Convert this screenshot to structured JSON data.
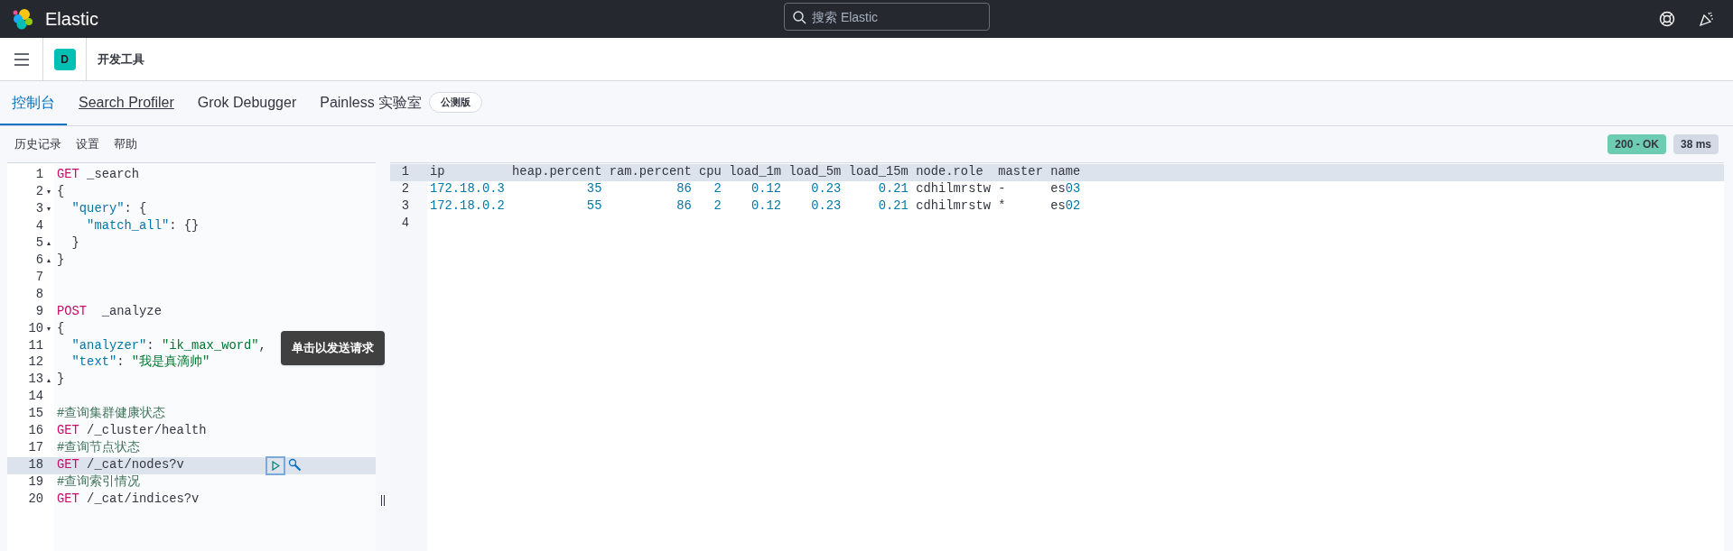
{
  "header": {
    "brand": "Elastic",
    "search": {
      "placeholder": "搜索 Elastic"
    }
  },
  "app_bar": {
    "avatar": "D",
    "breadcrumb": "开发工具"
  },
  "tabs": [
    {
      "label": "控制台",
      "selected": true
    },
    {
      "label": "Search Profiler",
      "selected": false,
      "underlined": true
    },
    {
      "label": "Grok Debugger",
      "selected": false
    },
    {
      "label": "Painless 实验室",
      "selected": false,
      "badge": "公测版"
    }
  ],
  "toolbar": {
    "links": [
      "历史记录",
      "设置",
      "帮助"
    ],
    "status": "200 - OK",
    "time": "38 ms"
  },
  "editor": {
    "tooltip": "单击以发送请求",
    "lines": [
      {
        "number": "1",
        "active": false,
        "segments": [
          {
            "kind": "method",
            "text": "GET"
          },
          {
            "kind": "path",
            "text": " _search"
          }
        ]
      },
      {
        "number": "2",
        "active": false,
        "fold": "▾",
        "segments": [
          {
            "kind": "punct",
            "text": "{"
          }
        ]
      },
      {
        "number": "3",
        "active": false,
        "fold": "▾",
        "segments": [
          {
            "kind": "key",
            "text": "  \"query\""
          },
          {
            "kind": "punct",
            "text": ": {"
          }
        ]
      },
      {
        "number": "4",
        "active": false,
        "segments": [
          {
            "kind": "key",
            "text": "    \"match_all\""
          },
          {
            "kind": "punct",
            "text": ": {}"
          }
        ]
      },
      {
        "number": "5",
        "active": false,
        "fold": "▴",
        "segments": [
          {
            "kind": "punct",
            "text": "  }"
          }
        ]
      },
      {
        "number": "6",
        "active": false,
        "fold": "▴",
        "segments": [
          {
            "kind": "punct",
            "text": "}"
          }
        ]
      },
      {
        "number": "7",
        "active": false
      },
      {
        "number": "8",
        "active": false
      },
      {
        "number": "9",
        "active": false,
        "segments": [
          {
            "kind": "method",
            "text": "POST"
          },
          {
            "kind": "path",
            "text": "  _analyze"
          }
        ]
      },
      {
        "number": "10",
        "active": false,
        "fold": "▾",
        "segments": [
          {
            "kind": "punct",
            "text": "{"
          }
        ]
      },
      {
        "number": "11",
        "active": false,
        "segments": [
          {
            "kind": "key",
            "text": "  \"analyzer\""
          },
          {
            "kind": "punct",
            "text": ": "
          },
          {
            "kind": "string",
            "text": "\"ik_max_word\""
          },
          {
            "kind": "punct",
            "text": ","
          }
        ]
      },
      {
        "number": "12",
        "active": false,
        "segments": [
          {
            "kind": "key",
            "text": "  \"text\""
          },
          {
            "kind": "punct",
            "text": ": "
          },
          {
            "kind": "string",
            "text": "\"我是真滴帅\""
          }
        ]
      },
      {
        "number": "13",
        "active": false,
        "fold": "▴",
        "segments": [
          {
            "kind": "punct",
            "text": "}"
          }
        ]
      },
      {
        "number": "14",
        "active": false
      },
      {
        "number": "15",
        "active": false,
        "segments": [
          {
            "kind": "comment",
            "text": "#查询集群健康状态"
          }
        ]
      },
      {
        "number": "16",
        "active": false,
        "segments": [
          {
            "kind": "method",
            "text": "GET"
          },
          {
            "kind": "path",
            "text": " /_cluster/health"
          }
        ]
      },
      {
        "number": "17",
        "active": false,
        "segments": [
          {
            "kind": "comment",
            "text": "#查询节点状态"
          }
        ]
      },
      {
        "number": "18",
        "active": true,
        "segments": [
          {
            "kind": "method",
            "text": "GET"
          },
          {
            "kind": "path",
            "text": " /_cat/nodes?v"
          }
        ]
      },
      {
        "number": "19",
        "active": false,
        "segments": [
          {
            "kind": "comment",
            "text": "#查询索引情况"
          }
        ]
      },
      {
        "number": "20",
        "active": false,
        "segments": [
          {
            "kind": "method",
            "text": "GET"
          },
          {
            "kind": "path",
            "text": " /_cat/indices?v"
          }
        ]
      }
    ]
  },
  "output": {
    "lines": [
      {
        "number": "1",
        "highlighted": true,
        "segments": [
          {
            "kind": "text",
            "text": "ip         heap.percent ram.percent cpu load_1m load_5m load_15m node.role  master name"
          }
        ]
      },
      {
        "number": "2",
        "highlighted": false,
        "segments": [
          {
            "kind": "number",
            "text": "172.18.0.3           35          86   2    0.12    0.23     0.21"
          },
          {
            "kind": "text",
            "text": " cdhilmrstw -      es"
          },
          {
            "kind": "number",
            "text": "03"
          }
        ]
      },
      {
        "number": "3",
        "highlighted": false,
        "segments": [
          {
            "kind": "number",
            "text": "172.18.0.2           55          86   2    0.12    0.23     0.21"
          },
          {
            "kind": "text",
            "text": " cdhilmrstw *      es"
          },
          {
            "kind": "number",
            "text": "02"
          }
        ]
      },
      {
        "number": "4",
        "highlighted": false
      }
    ]
  }
}
